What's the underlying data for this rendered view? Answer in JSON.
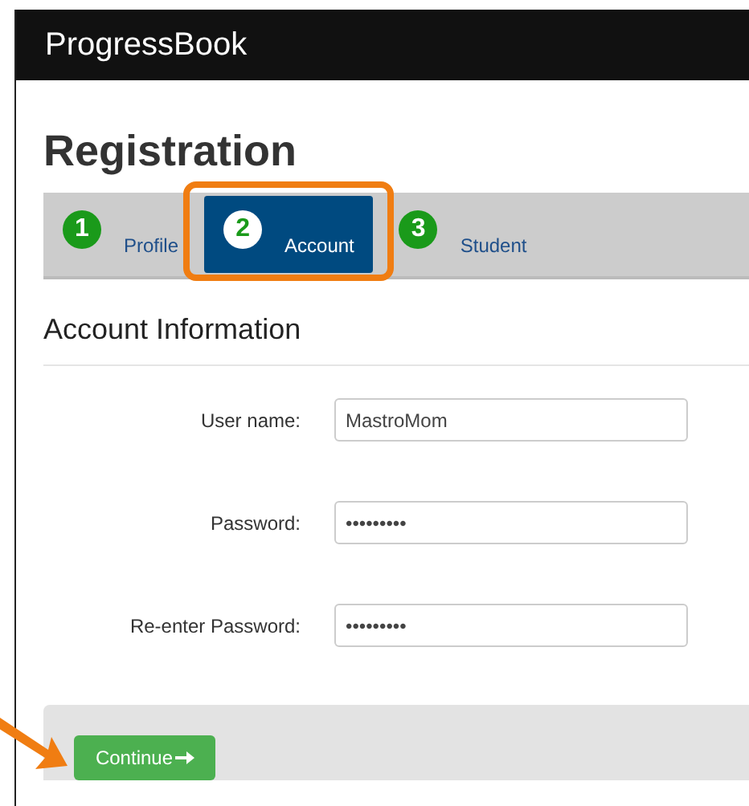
{
  "header": {
    "brand": "ProgressBook"
  },
  "page_title": "Registration",
  "steps": [
    {
      "number": "1",
      "label": "Profile",
      "selected": false,
      "highlighted": false
    },
    {
      "number": "2",
      "label": "Account",
      "selected": true,
      "highlighted": true
    },
    {
      "number": "3",
      "label": "Student",
      "selected": false,
      "highlighted": false
    }
  ],
  "section_title": "Account Information",
  "fields": [
    {
      "label": "User name:",
      "value": "MastroMom"
    },
    {
      "label": "Password:",
      "value": "•••••••••"
    },
    {
      "label": "Re-enter Password:",
      "value": "•••••••••"
    }
  ],
  "footer": {
    "button": "Continue",
    "arrow_pointer": true
  }
}
